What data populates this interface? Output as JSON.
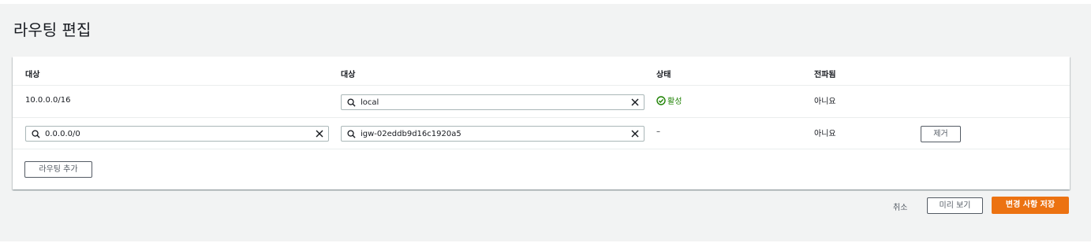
{
  "page": {
    "title": "라우팅 편집"
  },
  "table": {
    "headers": [
      "대상",
      "대상",
      "상태",
      "전파됨"
    ],
    "rows": [
      {
        "destination": "10.0.0.0/16",
        "target": "local",
        "status": "활성",
        "propagated": "아니요"
      },
      {
        "destination": "0.0.0.0/0",
        "target": "igw-02eddb9d16c1920a5",
        "status": "–",
        "propagated": "아니요",
        "remove_label": "제거"
      }
    ],
    "add_route_label": "라우팅 추가"
  },
  "footer": {
    "cancel_label": "취소",
    "preview_label": "미리 보기",
    "save_label": "변경 사항 저장"
  },
  "colors": {
    "primary": "#ec7211",
    "success": "#1d8102",
    "background": "#f2f3f3"
  },
  "icons": [
    "search-icon",
    "clear-icon",
    "status-check-icon"
  ]
}
